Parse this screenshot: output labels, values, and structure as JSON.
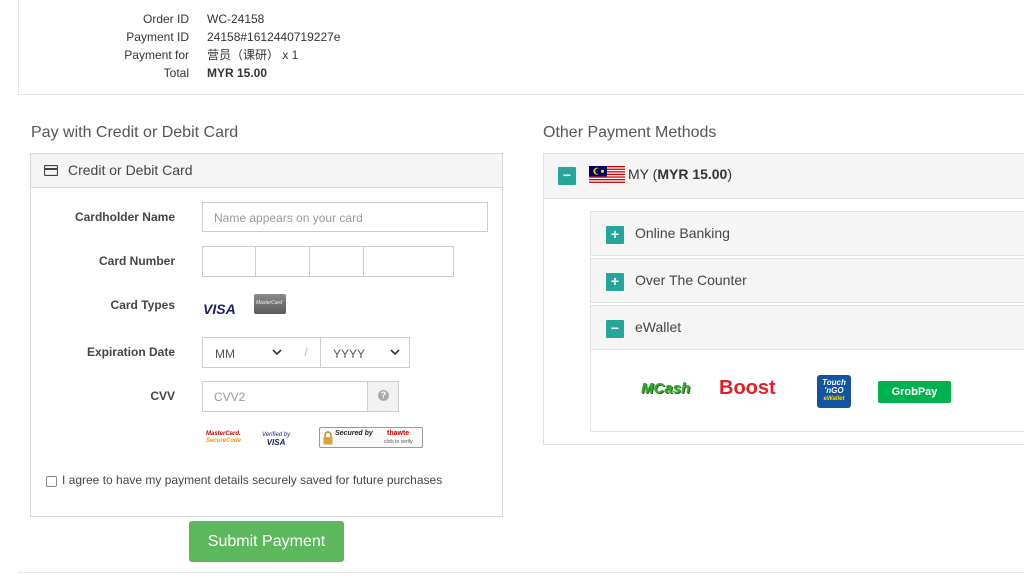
{
  "order": {
    "rows": [
      {
        "label": "Order ID",
        "value": "WC-24158"
      },
      {
        "label": "Payment ID",
        "value": "24158#1612440719227e"
      },
      {
        "label": "Payment for",
        "value": "营员（课研） x 1"
      },
      {
        "label": "Total",
        "value": "MYR 15.00"
      }
    ]
  },
  "card_section": {
    "heading": "Pay with Credit or Debit Card",
    "panel_title": "Credit or Debit Card",
    "cardholder_label": "Cardholder Name",
    "cardholder_placeholder": "Name appears on your card",
    "card_number_label": "Card Number",
    "card_types_label": "Card Types",
    "visa_text": "VISA",
    "mastercard_text": "MasterCard",
    "expiration_label": "Expiration Date",
    "exp_month": "MM",
    "exp_separator": "/",
    "exp_year": "YYYY",
    "cvv_label": "CVV",
    "cvv_placeholder": "CVV2",
    "cvv_help": "?",
    "badge_mastercard_line1": "MasterCard.",
    "badge_mastercard_line2": "SecureCode",
    "badge_visa_line1": "Verified by",
    "badge_visa_line2": "VISA",
    "badge_secured_line1": "Secured by",
    "badge_secured_brand": "thawte",
    "badge_secured_line2": "click to verify",
    "save_consent": "I agree to have my payment details securely saved for future purchases",
    "submit_label": "Submit Payment"
  },
  "other_section": {
    "heading": "Other Payment Methods",
    "country_code": "MY",
    "country_amount": "MYR 15.00",
    "methods": [
      {
        "label": "Online Banking",
        "toggle": "+"
      },
      {
        "label": "Over The Counter",
        "toggle": "+"
      },
      {
        "label": "eWallet",
        "toggle": "−"
      }
    ],
    "country_toggle": "−",
    "wallets": {
      "mcash": "MCash",
      "boost": "Boost",
      "tng_line1": "Touch",
      "tng_line2": "'nGO",
      "tng_line3": "eWallet",
      "grabpay": "GrobPay"
    }
  },
  "colors": {
    "accent_green": "#5cb85c",
    "toggle_teal": "#26a69a",
    "boost_red": "#e31f26",
    "mcash_green": "#3aa935",
    "tng_blue": "#1254a1",
    "grab_green": "#00b14f"
  }
}
